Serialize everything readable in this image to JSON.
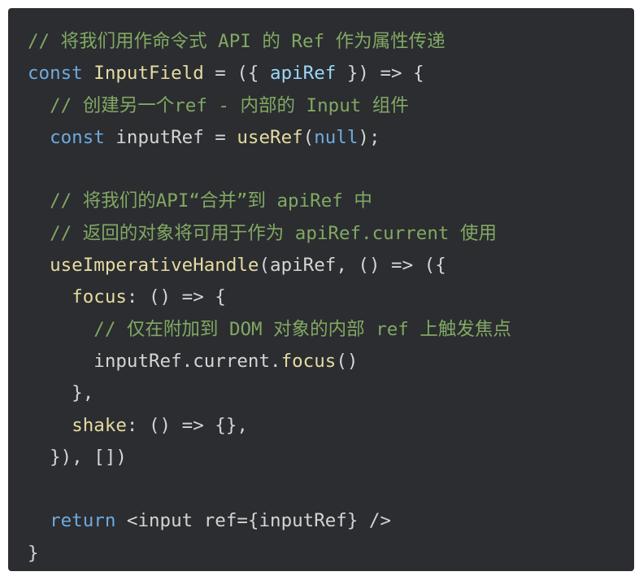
{
  "code": {
    "language": "javascript",
    "colors": {
      "background": "#2b2d31",
      "comment": "#82a862",
      "keyword": "#6fa9dc",
      "text": "#d4d4d4",
      "function": "#e6dba0",
      "variable": "#9cd6f8"
    },
    "lines": [
      [
        {
          "t": "comment",
          "v": "// 将我们用作命令式 API 的 Ref 作为属性传递"
        }
      ],
      [
        {
          "t": "keyword",
          "v": "const"
        },
        {
          "t": "punct",
          "v": " "
        },
        {
          "t": "type",
          "v": "InputField"
        },
        {
          "t": "punct",
          "v": " = ({ "
        },
        {
          "t": "var",
          "v": "apiRef"
        },
        {
          "t": "punct",
          "v": " }) => {"
        }
      ],
      [
        {
          "t": "punct",
          "v": "  "
        },
        {
          "t": "comment",
          "v": "// 创建另一个ref - 内部的 Input 组件"
        }
      ],
      [
        {
          "t": "punct",
          "v": "  "
        },
        {
          "t": "keyword",
          "v": "const"
        },
        {
          "t": "punct",
          "v": " "
        },
        {
          "t": "ident",
          "v": "inputRef"
        },
        {
          "t": "punct",
          "v": " = "
        },
        {
          "t": "func",
          "v": "useRef"
        },
        {
          "t": "punct",
          "v": "("
        },
        {
          "t": "literal",
          "v": "null"
        },
        {
          "t": "punct",
          "v": ");"
        }
      ],
      [],
      [
        {
          "t": "punct",
          "v": "  "
        },
        {
          "t": "comment",
          "v": "// 将我们的API“合并”到 apiRef 中"
        }
      ],
      [
        {
          "t": "punct",
          "v": "  "
        },
        {
          "t": "comment",
          "v": "// 返回的对象将可用于作为 apiRef.current 使用"
        }
      ],
      [
        {
          "t": "punct",
          "v": "  "
        },
        {
          "t": "func",
          "v": "useImperativeHandle"
        },
        {
          "t": "punct",
          "v": "("
        },
        {
          "t": "ident",
          "v": "apiRef"
        },
        {
          "t": "punct",
          "v": ", () => ({"
        }
      ],
      [
        {
          "t": "punct",
          "v": "    "
        },
        {
          "t": "prop",
          "v": "focus"
        },
        {
          "t": "punct",
          "v": ": () => {"
        }
      ],
      [
        {
          "t": "punct",
          "v": "      "
        },
        {
          "t": "comment",
          "v": "// 仅在附加到 DOM 对象的内部 ref 上触发焦点"
        }
      ],
      [
        {
          "t": "punct",
          "v": "      "
        },
        {
          "t": "ident",
          "v": "inputRef"
        },
        {
          "t": "punct",
          "v": "."
        },
        {
          "t": "ident",
          "v": "current"
        },
        {
          "t": "punct",
          "v": "."
        },
        {
          "t": "func",
          "v": "focus"
        },
        {
          "t": "punct",
          "v": "()"
        }
      ],
      [
        {
          "t": "punct",
          "v": "    },"
        }
      ],
      [
        {
          "t": "punct",
          "v": "    "
        },
        {
          "t": "prop",
          "v": "shake"
        },
        {
          "t": "punct",
          "v": ": () => {},"
        }
      ],
      [
        {
          "t": "punct",
          "v": "  }), [])"
        }
      ],
      [],
      [
        {
          "t": "punct",
          "v": "  "
        },
        {
          "t": "keyword",
          "v": "return"
        },
        {
          "t": "punct",
          "v": " "
        },
        {
          "t": "tag",
          "v": "<input ref={inputRef} />"
        }
      ],
      [
        {
          "t": "punct",
          "v": "}"
        }
      ]
    ]
  }
}
